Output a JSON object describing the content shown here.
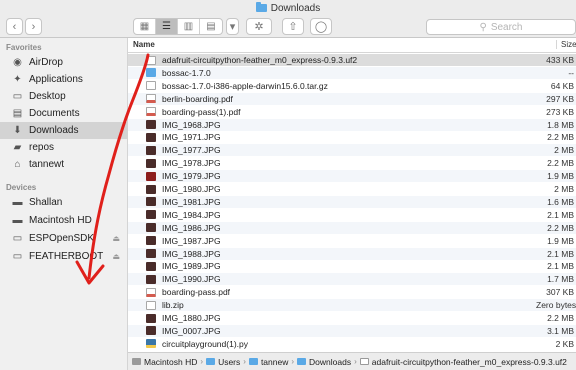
{
  "window": {
    "title": "Downloads"
  },
  "toolbar": {
    "back_glyph": "‹",
    "forward_glyph": "›",
    "view_icons": [
      "icon-view-icon",
      "list-view-icon",
      "column-view-icon",
      "cover-flow-icon"
    ],
    "search_placeholder": "Search"
  },
  "sidebar": {
    "favorites_header": "Favorites",
    "favorites": [
      {
        "label": "AirDrop",
        "icon": "airdrop-icon",
        "glyph": "◉"
      },
      {
        "label": "Applications",
        "icon": "applications-icon",
        "glyph": "✦"
      },
      {
        "label": "Desktop",
        "icon": "desktop-icon",
        "glyph": "▭"
      },
      {
        "label": "Documents",
        "icon": "documents-icon",
        "glyph": "▤"
      },
      {
        "label": "Downloads",
        "icon": "downloads-icon",
        "glyph": "⬇"
      },
      {
        "label": "repos",
        "icon": "folder-icon",
        "glyph": "▰"
      },
      {
        "label": "tannewt",
        "icon": "home-icon",
        "glyph": "⌂"
      }
    ],
    "devices_header": "Devices",
    "devices": [
      {
        "label": "Shallan",
        "icon": "computer-icon",
        "glyph": "▬"
      },
      {
        "label": "Macintosh HD",
        "icon": "hard-disk-icon",
        "glyph": "▬"
      },
      {
        "label": "ESPOpenSDK",
        "icon": "external-disk-icon",
        "glyph": "▭",
        "eject": true
      },
      {
        "label": "FEATHERBOOT",
        "icon": "external-disk-icon",
        "glyph": "▭",
        "eject": true
      }
    ],
    "eject_glyph": "⏏"
  },
  "columns": {
    "name": "Name",
    "size": "Size"
  },
  "files": [
    {
      "name": "adafruit-circuitpython-feather_m0_express-0.9.3.uf2",
      "size": "433 KB",
      "type": "doc"
    },
    {
      "name": "bossac-1.7.0",
      "size": "--",
      "type": "folder"
    },
    {
      "name": "bossac-1.7.0-i386-apple-darwin15.6.0.tar.gz",
      "size": "64 KB",
      "type": "doc"
    },
    {
      "name": "berlin-boarding.pdf",
      "size": "297 KB",
      "type": "pdf"
    },
    {
      "name": "boarding-pass(1).pdf",
      "size": "273 KB",
      "type": "pdf"
    },
    {
      "name": "IMG_1968.JPG",
      "size": "1.8 MB",
      "type": "jpg"
    },
    {
      "name": "IMG_1971.JPG",
      "size": "2.2 MB",
      "type": "jpg"
    },
    {
      "name": "IMG_1977.JPG",
      "size": "2 MB",
      "type": "jpg"
    },
    {
      "name": "IMG_1978.JPG",
      "size": "2.2 MB",
      "type": "jpg"
    },
    {
      "name": "IMG_1979.JPG",
      "size": "1.9 MB",
      "type": "jpgr"
    },
    {
      "name": "IMG_1980.JPG",
      "size": "2 MB",
      "type": "jpg"
    },
    {
      "name": "IMG_1981.JPG",
      "size": "1.6 MB",
      "type": "jpg"
    },
    {
      "name": "IMG_1984.JPG",
      "size": "2.1 MB",
      "type": "jpg"
    },
    {
      "name": "IMG_1986.JPG",
      "size": "2.2 MB",
      "type": "jpg"
    },
    {
      "name": "IMG_1987.JPG",
      "size": "1.9 MB",
      "type": "jpg"
    },
    {
      "name": "IMG_1988.JPG",
      "size": "2.1 MB",
      "type": "jpg"
    },
    {
      "name": "IMG_1989.JPG",
      "size": "2.1 MB",
      "type": "jpg"
    },
    {
      "name": "IMG_1990.JPG",
      "size": "1.7 MB",
      "type": "jpg"
    },
    {
      "name": "boarding-pass.pdf",
      "size": "307 KB",
      "type": "pdf"
    },
    {
      "name": "lib.zip",
      "size": "Zero bytes",
      "type": "doc"
    },
    {
      "name": "IMG_1880.JPG",
      "size": "2.2 MB",
      "type": "jpg"
    },
    {
      "name": "IMG_0007.JPG",
      "size": "3.1 MB",
      "type": "jpg"
    },
    {
      "name": "circuitplayground(1).py",
      "size": "2 KB",
      "type": "py"
    }
  ],
  "pathbar": {
    "items": [
      {
        "label": "Macintosh HD",
        "icon": "disk"
      },
      {
        "label": "Users",
        "icon": "folder"
      },
      {
        "label": "tannew",
        "icon": "folder"
      },
      {
        "label": "Downloads",
        "icon": "folder"
      },
      {
        "label": "adafruit-circuitpython-feather_m0_express-0.9.3.uf2",
        "icon": "file"
      }
    ],
    "separator": "›"
  },
  "annotation_color": "#e0201b"
}
